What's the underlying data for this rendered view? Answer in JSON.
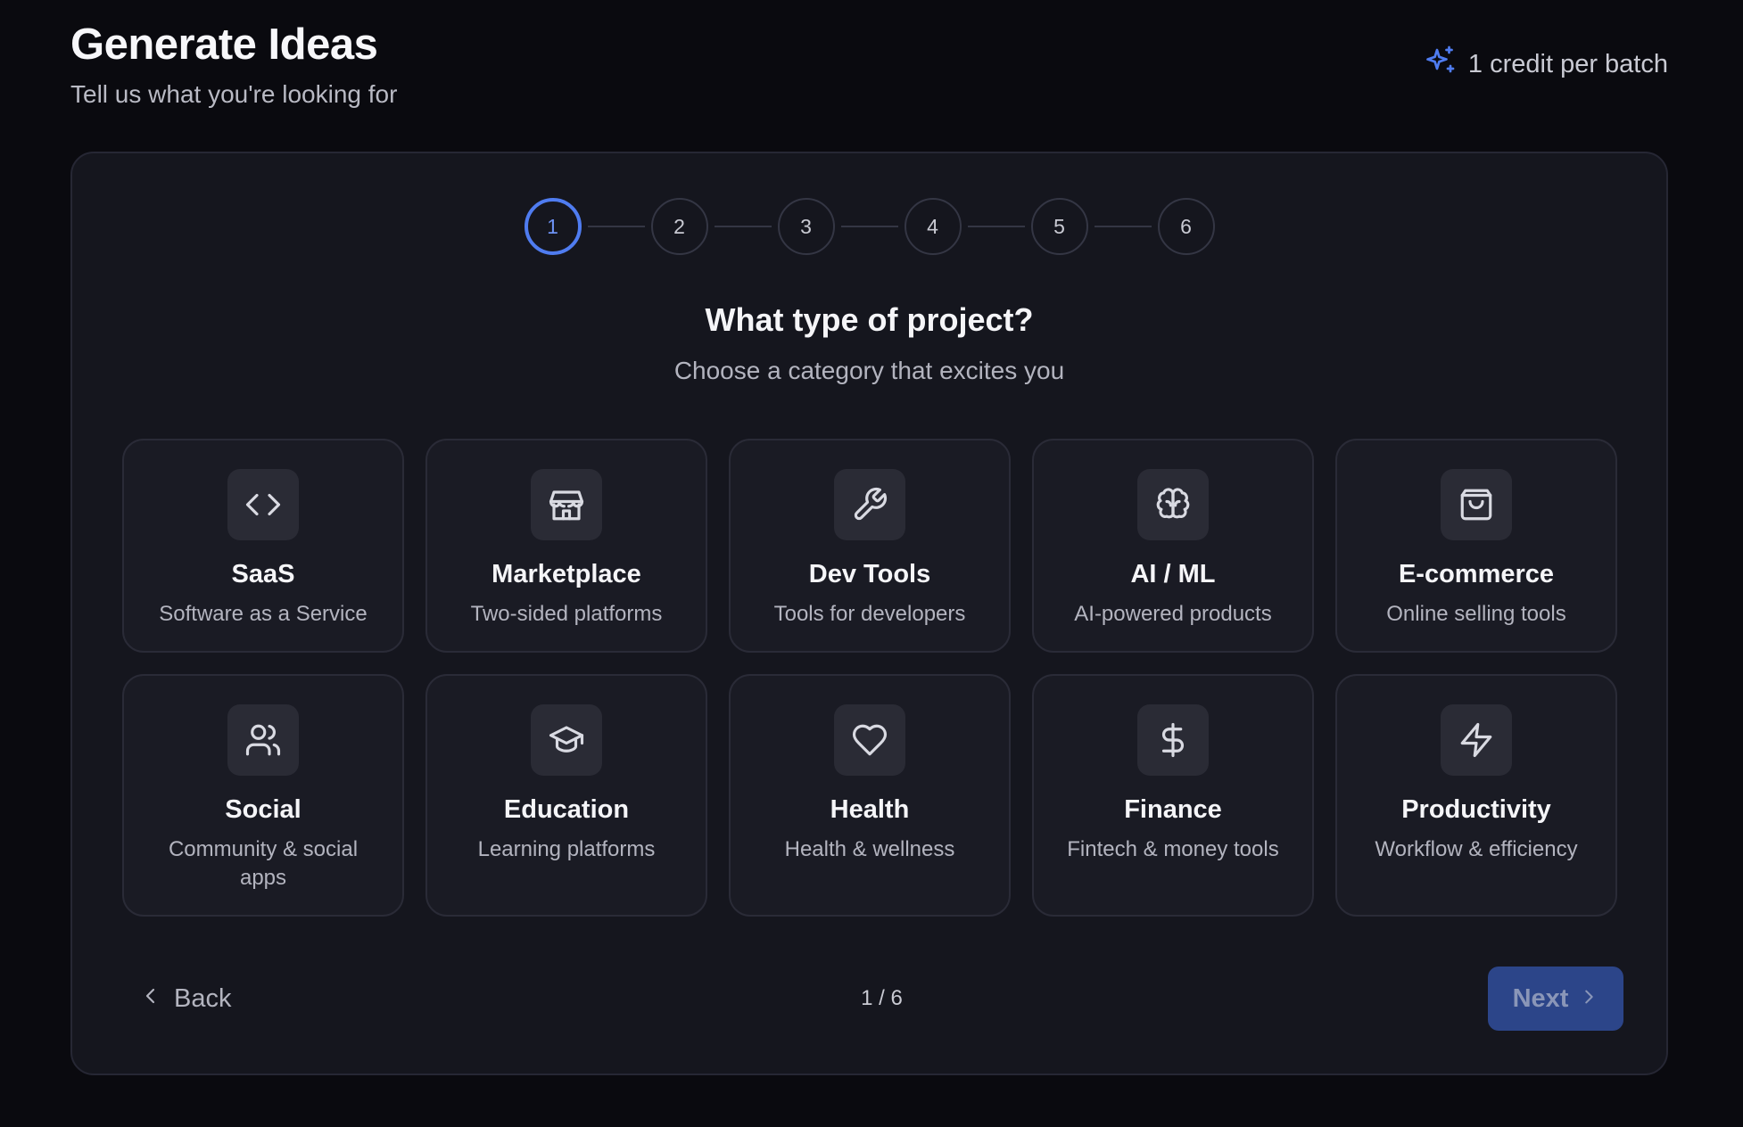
{
  "header": {
    "title": "Generate Ideas",
    "subtitle": "Tell us what you're looking for",
    "credit_text": "1 credit per batch",
    "credit_icon": "sparkles-icon"
  },
  "stepper": {
    "steps": [
      "1",
      "2",
      "3",
      "4",
      "5",
      "6"
    ],
    "active": 1
  },
  "question": {
    "title": "What type of project?",
    "hint": "Choose a category that excites you"
  },
  "categories": [
    {
      "name": "SaaS",
      "desc": "Software as a Service",
      "icon": "code-icon"
    },
    {
      "name": "Marketplace",
      "desc": "Two-sided platforms",
      "icon": "store-icon"
    },
    {
      "name": "Dev Tools",
      "desc": "Tools for developers",
      "icon": "wrench-icon"
    },
    {
      "name": "AI / ML",
      "desc": "AI-powered products",
      "icon": "brain-icon"
    },
    {
      "name": "E-commerce",
      "desc": "Online selling tools",
      "icon": "shopping-bag-icon"
    },
    {
      "name": "Social",
      "desc": "Community & social apps",
      "icon": "users-icon"
    },
    {
      "name": "Education",
      "desc": "Learning platforms",
      "icon": "graduation-cap-icon"
    },
    {
      "name": "Health",
      "desc": "Health & wellness",
      "icon": "heart-icon"
    },
    {
      "name": "Finance",
      "desc": "Fintech & money tools",
      "icon": "dollar-icon"
    },
    {
      "name": "Productivity",
      "desc": "Workflow & efficiency",
      "icon": "lightning-icon"
    }
  ],
  "footer": {
    "back_label": "Back",
    "page_indicator": "1 / 6",
    "next_label": "Next"
  },
  "colors": {
    "accent": "#4f7cf0",
    "background": "#0a0a0f",
    "card": "#15161e",
    "next_button": "#2c4589"
  }
}
